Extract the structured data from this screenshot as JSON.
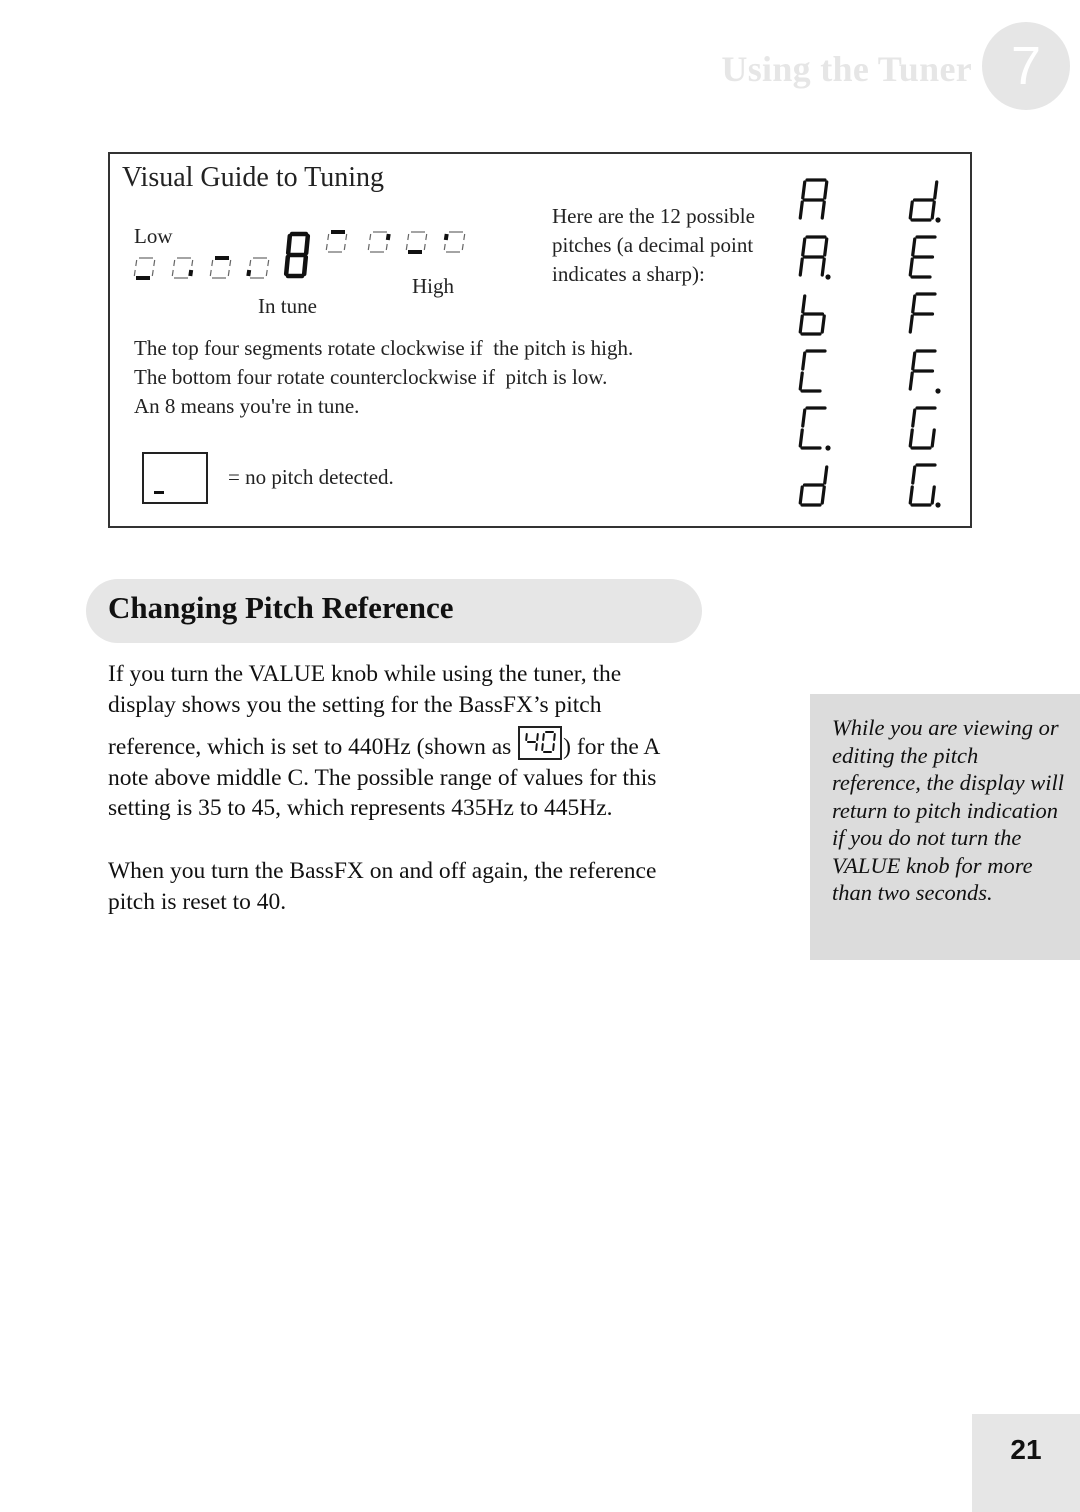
{
  "header": {
    "chapter_title": "Using the Tuner",
    "chapter_number": "7"
  },
  "visual_guide": {
    "title": "Visual Guide to Tuning",
    "label_low": "Low",
    "label_high": "High",
    "label_in_tune": "In tune",
    "pitch_note_lines": [
      "Here are the 12 possible",
      "pitches (a decimal point",
      "indicates a sharp):"
    ],
    "description_lines": [
      "The top four segments rotate clockwise if  the pitch is high.",
      "The bottom four rotate counterclockwise if  pitch is low.",
      "An 8 means you're in tune."
    ],
    "no_pitch_text": "= no pitch detected.",
    "tuner_strip": [
      {
        "position": "low-1",
        "segment": "bottom",
        "arrow": "right-below"
      },
      {
        "position": "low-2",
        "segment": "lower-right",
        "arrow": "up-right"
      },
      {
        "position": "low-3",
        "segment": "middle",
        "arrow": "left-above"
      },
      {
        "position": "low-4",
        "segment": "lower-left",
        "arrow": "down-left"
      },
      {
        "position": "in-tune",
        "segment": "all",
        "arrow": "none"
      },
      {
        "position": "high-1",
        "segment": "top",
        "arrow": "right-above"
      },
      {
        "position": "high-2",
        "segment": "upper-right",
        "arrow": "down-right"
      },
      {
        "position": "high-3",
        "segment": "middle",
        "arrow": "left-below"
      },
      {
        "position": "high-4",
        "segment": "upper-left",
        "arrow": "up-left"
      }
    ],
    "pitches": [
      {
        "note": "A",
        "sharp": false
      },
      {
        "note": "A",
        "sharp": true
      },
      {
        "note": "b",
        "sharp": false
      },
      {
        "note": "C",
        "sharp": false
      },
      {
        "note": "C",
        "sharp": true
      },
      {
        "note": "d",
        "sharp": false
      },
      {
        "note": "d",
        "sharp": true
      },
      {
        "note": "E",
        "sharp": false
      },
      {
        "note": "F",
        "sharp": false
      },
      {
        "note": "F",
        "sharp": true
      },
      {
        "note": "G",
        "sharp": false
      },
      {
        "note": "G",
        "sharp": true
      }
    ]
  },
  "section": {
    "heading": "Changing Pitch Reference",
    "para1_line1": "If you turn the VALUE knob while using the tuner, the",
    "para1_line2": "display shows you the setting for the BassFX’s pitch",
    "para1_line3_pre": "reference, which is set to 440Hz (shown as ",
    "inline_display_value": "40",
    "para1_line3_post": ") for the A",
    "para1_line4": "note above middle C. The possible range of values for this",
    "para1_line5": "setting is 35 to 45, which represents 435Hz to 445Hz.",
    "para2_line1": "When you turn the BassFX on and off again, the reference",
    "para2_line2": "pitch is reset to 40."
  },
  "sidebar_note": {
    "text": "While you are viewing or editing the pitch reference, the display will return to pitch indication if you do not turn the VALUE knob for more than two seconds."
  },
  "footer": {
    "page_number": "21"
  }
}
